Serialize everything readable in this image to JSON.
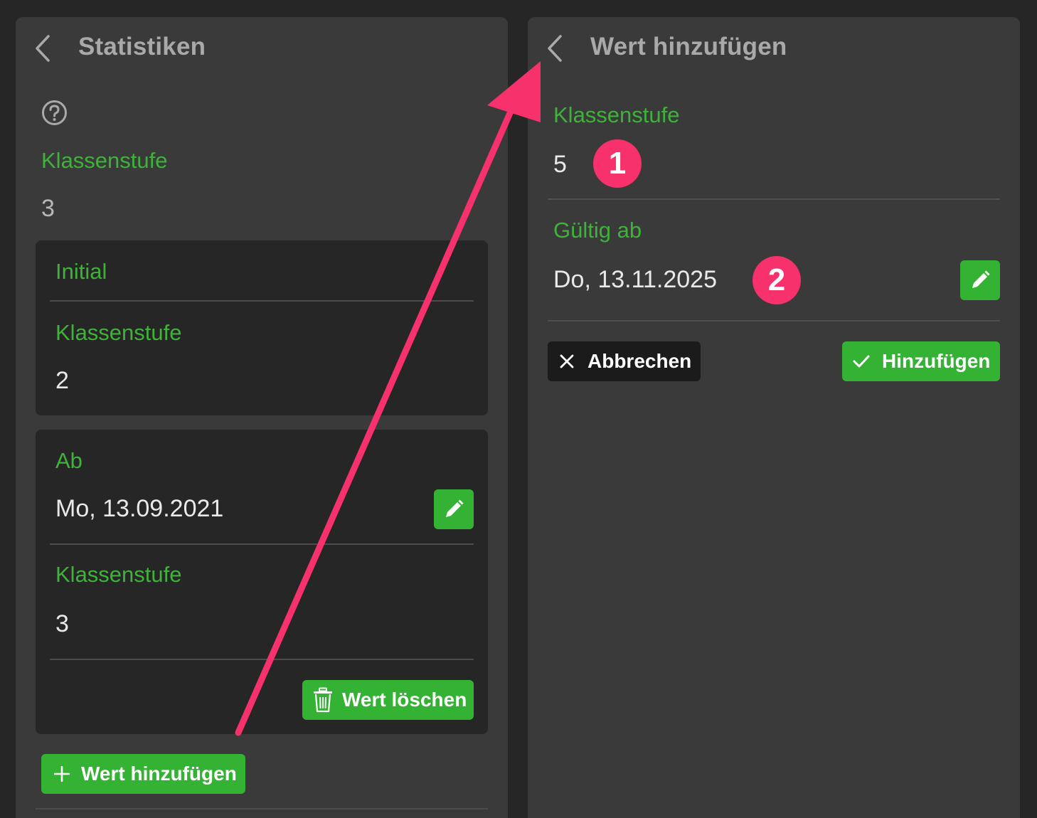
{
  "left": {
    "header_title": "Statistiken",
    "top_label": "Klassenstufe",
    "top_value": "3",
    "initial_card": {
      "heading": "Initial",
      "label": "Klassenstufe",
      "value": "2"
    },
    "entry_card": {
      "date_label": "Ab",
      "date_value": "Mo, 13.09.2021",
      "grade_label": "Klassenstufe",
      "grade_value": "3",
      "delete_label": "Wert löschen"
    },
    "add_button_label": "Wert hinzufügen"
  },
  "right": {
    "header_title": "Wert hinzufügen",
    "grade_label": "Klassenstufe",
    "grade_value": "5",
    "valid_label": "Gültig ab",
    "valid_value": "Do, 13.11.2025",
    "cancel_label": "Abbrechen",
    "add_label": "Hinzufügen"
  },
  "annotations": {
    "badge_1": "1",
    "badge_2": "2"
  },
  "icons": {
    "back": "chevron-left-icon",
    "help": "question-circle-icon",
    "edit": "pencil-icon",
    "delete": "trash-icon",
    "add": "plus-icon",
    "cancel": "x-icon",
    "confirm": "check-icon"
  },
  "colors": {
    "background": "#262626",
    "panel": "#3a3a3a",
    "card": "#262626",
    "accent_green": "#34b233",
    "label_green": "#3fb23a",
    "annotation_pink": "#f7316b"
  }
}
